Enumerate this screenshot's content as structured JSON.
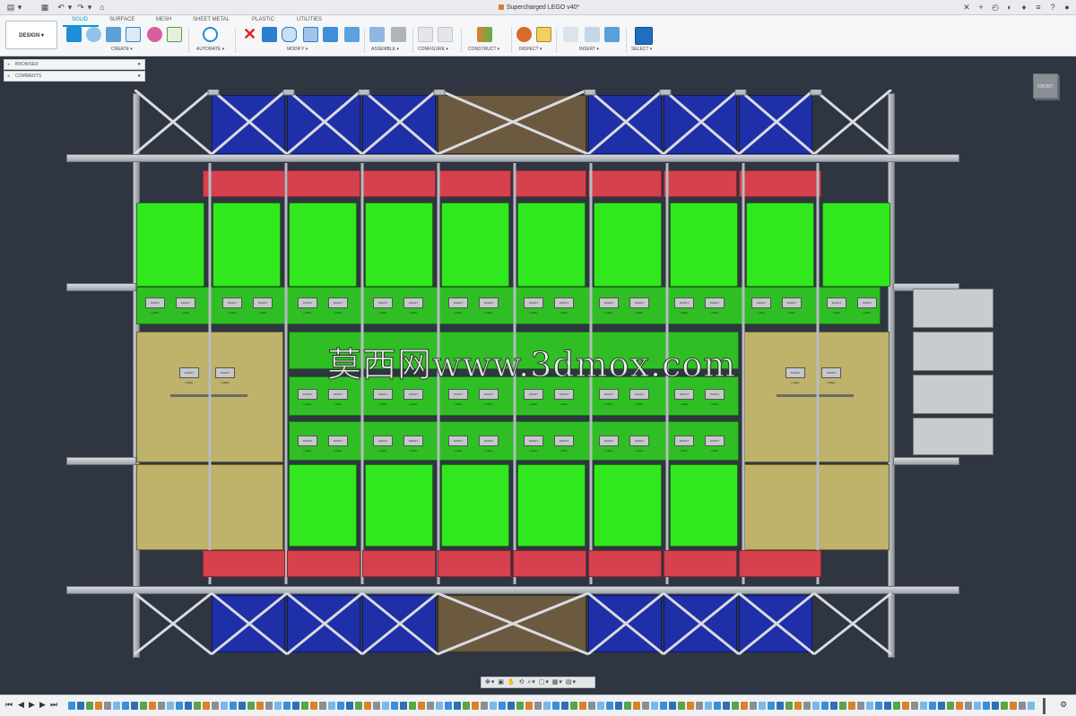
{
  "window": {
    "document_title": "Supercharged LEGO v40*",
    "left_buttons": [
      "▤",
      "▾",
      "▦",
      "↶",
      "▾",
      "↷",
      "▾",
      "⌂"
    ],
    "right_buttons": [
      "✕",
      "+",
      "◴",
      "◐",
      "♦",
      "≡",
      "?",
      "●"
    ]
  },
  "toolbar": {
    "workspace_button": "DESIGN ▾",
    "tabs": [
      "SOLID",
      "SURFACE",
      "MESH",
      "SHEET METAL",
      "PLASTIC",
      "UTILITIES"
    ],
    "active_tab": "SOLID",
    "groups": [
      {
        "label": "CREATE ▾"
      },
      {
        "label": "AUTOMATE ▾"
      },
      {
        "label": "MODIFY ▾"
      },
      {
        "label": "ASSEMBLE ▾"
      },
      {
        "label": "CONFIGURE ▾"
      },
      {
        "label": "CONSTRUCT ▾"
      },
      {
        "label": "INSPECT ▾"
      },
      {
        "label": "INSERT ▾"
      },
      {
        "label": "SELECT ▾"
      }
    ],
    "icon_colors": {
      "create": "#1e8fd6",
      "automate": "#1e8fd6",
      "modify_delete": "#e02020",
      "modify": "#2a7fd0",
      "assemble": "#8c8f94",
      "configure": "#b8bcc2",
      "construct": "#d9822b",
      "inspect": "#d86a2a",
      "insert": "#5aa0d8",
      "select": "#1e6fbd"
    }
  },
  "browser": {
    "browser_label": "BROWSER",
    "comments_label": "COMMENTS"
  },
  "viewcube": {
    "face_label": "FRONT"
  },
  "model": {
    "front_label_text": "FRONT LABEL",
    "colors": {
      "background": "#2f3641",
      "blue_bin": "#1f2fa8",
      "red_bin": "#d6414e",
      "green_tote": "#31e81e",
      "olive_panel": "#bfb26a",
      "frame": "#b4b8be"
    }
  },
  "watermark": "莫西网www.3dmox.com",
  "navbar": {
    "tools": "✥▾ ▣ ✋ ⟲ ⌕▾ ▢▾ ▦▾ ▤▾"
  },
  "timeline": {
    "controls": [
      "⏮",
      "◀",
      "▶",
      "▶",
      "⏭"
    ]
  }
}
